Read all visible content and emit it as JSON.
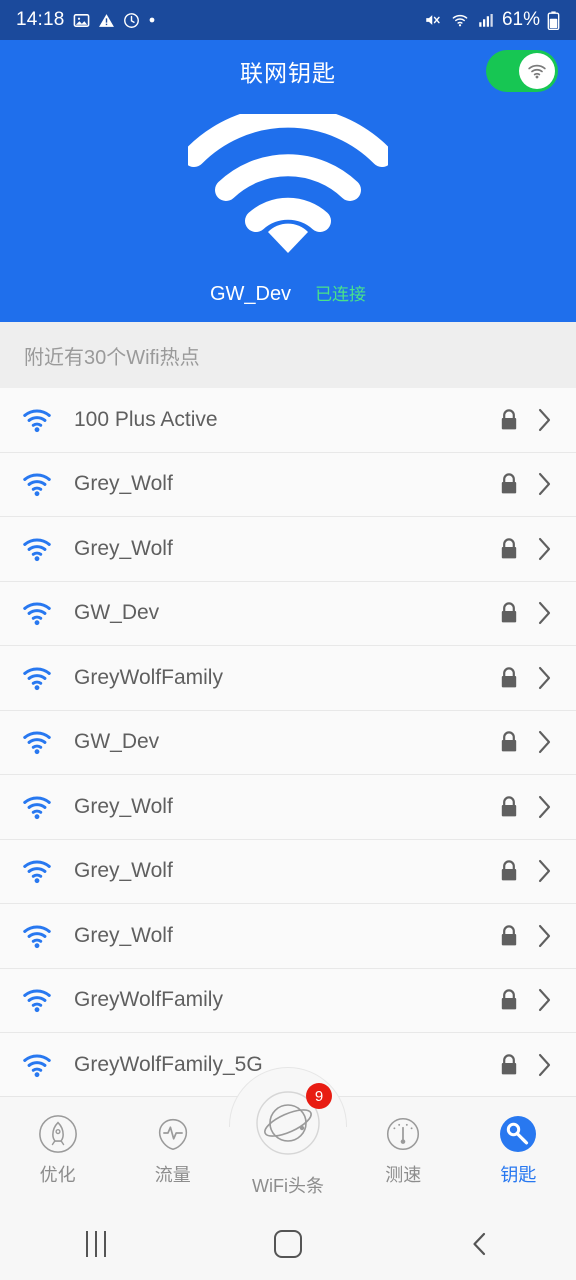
{
  "statusbar": {
    "time": "14:18",
    "battery": "61%",
    "icons_left": [
      "image-icon",
      "warning-icon",
      "alarm-icon",
      "dot-icon"
    ],
    "icons_right": [
      "mute-icon",
      "wifi-icon",
      "signal-icon",
      "battery-icon"
    ]
  },
  "header": {
    "title": "联网钥匙",
    "toggle_on": true,
    "toggle_icon": "wifi-icon",
    "hero_icon": "wifi-large-icon",
    "connected_ssid": "GW_Dev",
    "connected_state": "已连接",
    "accent_blue": "#1f6fec",
    "toggle_green": "#17c653",
    "state_green": "#49e28a"
  },
  "section": {
    "label": "附近有30个Wifi热点"
  },
  "networks": [
    {
      "ssid": "100 Plus Active",
      "secured": true
    },
    {
      "ssid": "Grey_Wolf",
      "secured": true
    },
    {
      "ssid": "Grey_Wolf",
      "secured": true
    },
    {
      "ssid": "GW_Dev",
      "secured": true
    },
    {
      "ssid": "GreyWolfFamily",
      "secured": true
    },
    {
      "ssid": "GW_Dev",
      "secured": true
    },
    {
      "ssid": "Grey_Wolf",
      "secured": true
    },
    {
      "ssid": "Grey_Wolf",
      "secured": true
    },
    {
      "ssid": "Grey_Wolf",
      "secured": true
    },
    {
      "ssid": "GreyWolfFamily",
      "secured": true
    },
    {
      "ssid": "GreyWolfFamily_5G",
      "secured": true
    }
  ],
  "tabbar": {
    "items": [
      {
        "label": "优化",
        "icon": "rocket-icon",
        "active": false
      },
      {
        "label": "流量",
        "icon": "pulse-icon",
        "active": false
      },
      {
        "label": "WiFi头条",
        "icon": "planet-icon",
        "active": false,
        "badge": "9"
      },
      {
        "label": "测速",
        "icon": "speedometer-icon",
        "active": false
      },
      {
        "label": "钥匙",
        "icon": "key-icon",
        "active": true
      }
    ],
    "active_color": "#2878f0",
    "badge_color": "#e81c12"
  },
  "navbar": {
    "recents": "recents-icon",
    "home": "home-icon",
    "back": "back-icon"
  }
}
